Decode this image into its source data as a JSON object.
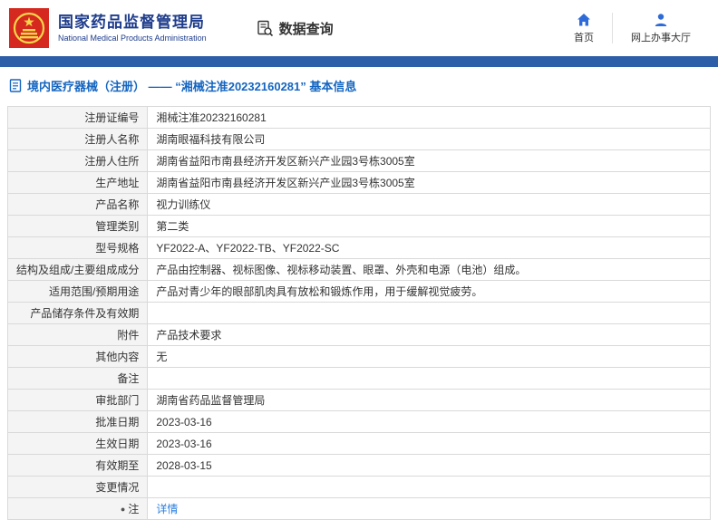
{
  "header": {
    "org_name_cn": "国家药品监督管理局",
    "org_name_en": "National Medical Products Administration",
    "data_query_label": "数据查询",
    "nav_home_label": "首页",
    "nav_hall_label": "网上办事大厅"
  },
  "page": {
    "breadcrumb": "境内医疗器械（注册） ——  “湘械注准20232160281”  基本信息"
  },
  "colors": {
    "header_blue": "#1e3c8c",
    "bar_blue": "#2d5fa9",
    "breadcrumb_blue": "#1465c0",
    "link_blue": "#2a7fde",
    "emblem_red": "#d5281e",
    "emblem_gold": "#f7d64a",
    "label_cell_bg": "#f4f4f4",
    "border_gray": "#d9d9d9"
  },
  "table": {
    "rows": [
      {
        "label": "注册证编号",
        "value": "湘械注准20232160281"
      },
      {
        "label": "注册人名称",
        "value": "湖南眼福科技有限公司"
      },
      {
        "label": "注册人住所",
        "value": "湖南省益阳市南县经济开发区新兴产业园3号栋3005室"
      },
      {
        "label": "生产地址",
        "value": "湖南省益阳市南县经济开发区新兴产业园3号栋3005室"
      },
      {
        "label": "产品名称",
        "value": "视力训练仪"
      },
      {
        "label": "管理类别",
        "value": "第二类"
      },
      {
        "label": "型号规格",
        "value": "YF2022-A、YF2022-TB、YF2022-SC"
      },
      {
        "label": "结构及组成/主要组成成分",
        "value": "产品由控制器、视标图像、视标移动装置、眼罩、外壳和电源（电池）组成。"
      },
      {
        "label": "适用范围/预期用途",
        "value": "产品对青少年的眼部肌肉具有放松和锻炼作用，用于缓解视觉疲劳。"
      },
      {
        "label": "产品储存条件及有效期",
        "value": ""
      },
      {
        "label": "附件",
        "value": "产品技术要求"
      },
      {
        "label": "其他内容",
        "value": "无"
      },
      {
        "label": "备注",
        "value": ""
      },
      {
        "label": "审批部门",
        "value": "湖南省药品监督管理局"
      },
      {
        "label": "批准日期",
        "value": "2023-03-16"
      },
      {
        "label": "生效日期",
        "value": "2023-03-16"
      },
      {
        "label": "有效期至",
        "value": "2028-03-15"
      },
      {
        "label": "变更情况",
        "value": ""
      },
      {
        "label": "注",
        "note_icon": true,
        "value": "详情",
        "link": true
      }
    ]
  }
}
